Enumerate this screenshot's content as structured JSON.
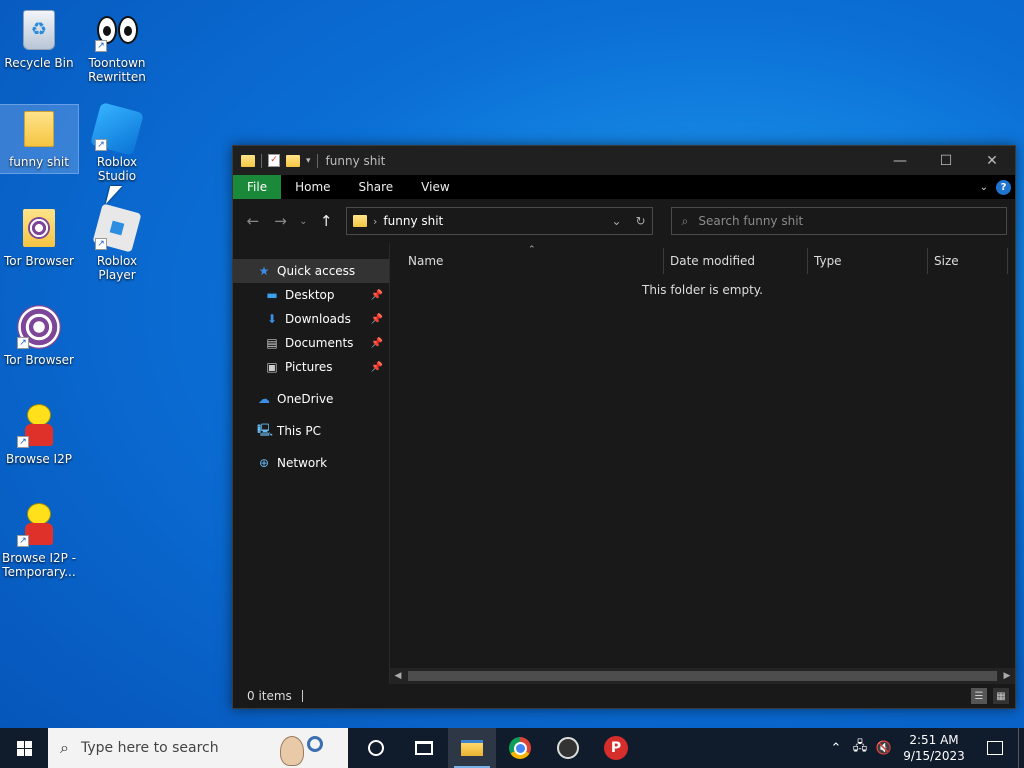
{
  "desktop": {
    "icons": [
      {
        "label": "Recycle Bin"
      },
      {
        "label": "Toontown Rewritten"
      },
      {
        "label": "funny shit"
      },
      {
        "label": "Roblox Studio"
      },
      {
        "label": "Tor Browser"
      },
      {
        "label": "Roblox Player"
      },
      {
        "label": "Tor Browser"
      },
      {
        "label": "Browse I2P"
      },
      {
        "label": "Browse I2P - Temporary..."
      }
    ]
  },
  "window": {
    "title": "funny shit",
    "ribbon_tabs": [
      "File",
      "Home",
      "Share",
      "View"
    ],
    "help_label": "?",
    "address_path": "funny shit",
    "search_placeholder": "Search funny shit",
    "nav": {
      "quick_access": "Quick access",
      "desktop": "Desktop",
      "downloads": "Downloads",
      "documents": "Documents",
      "pictures": "Pictures",
      "onedrive": "OneDrive",
      "this_pc": "This PC",
      "network": "Network"
    },
    "columns": [
      "Name",
      "Date modified",
      "Type",
      "Size"
    ],
    "empty_message": "This folder is empty.",
    "status": "0 items"
  },
  "taskbar": {
    "search_placeholder": "Type here to search",
    "time": "2:51 AM",
    "date": "9/15/2023"
  },
  "colors": {
    "file_tab": "#1a8a3a",
    "window_bg": "#191919",
    "taskbar_bg": "#101c2c"
  }
}
